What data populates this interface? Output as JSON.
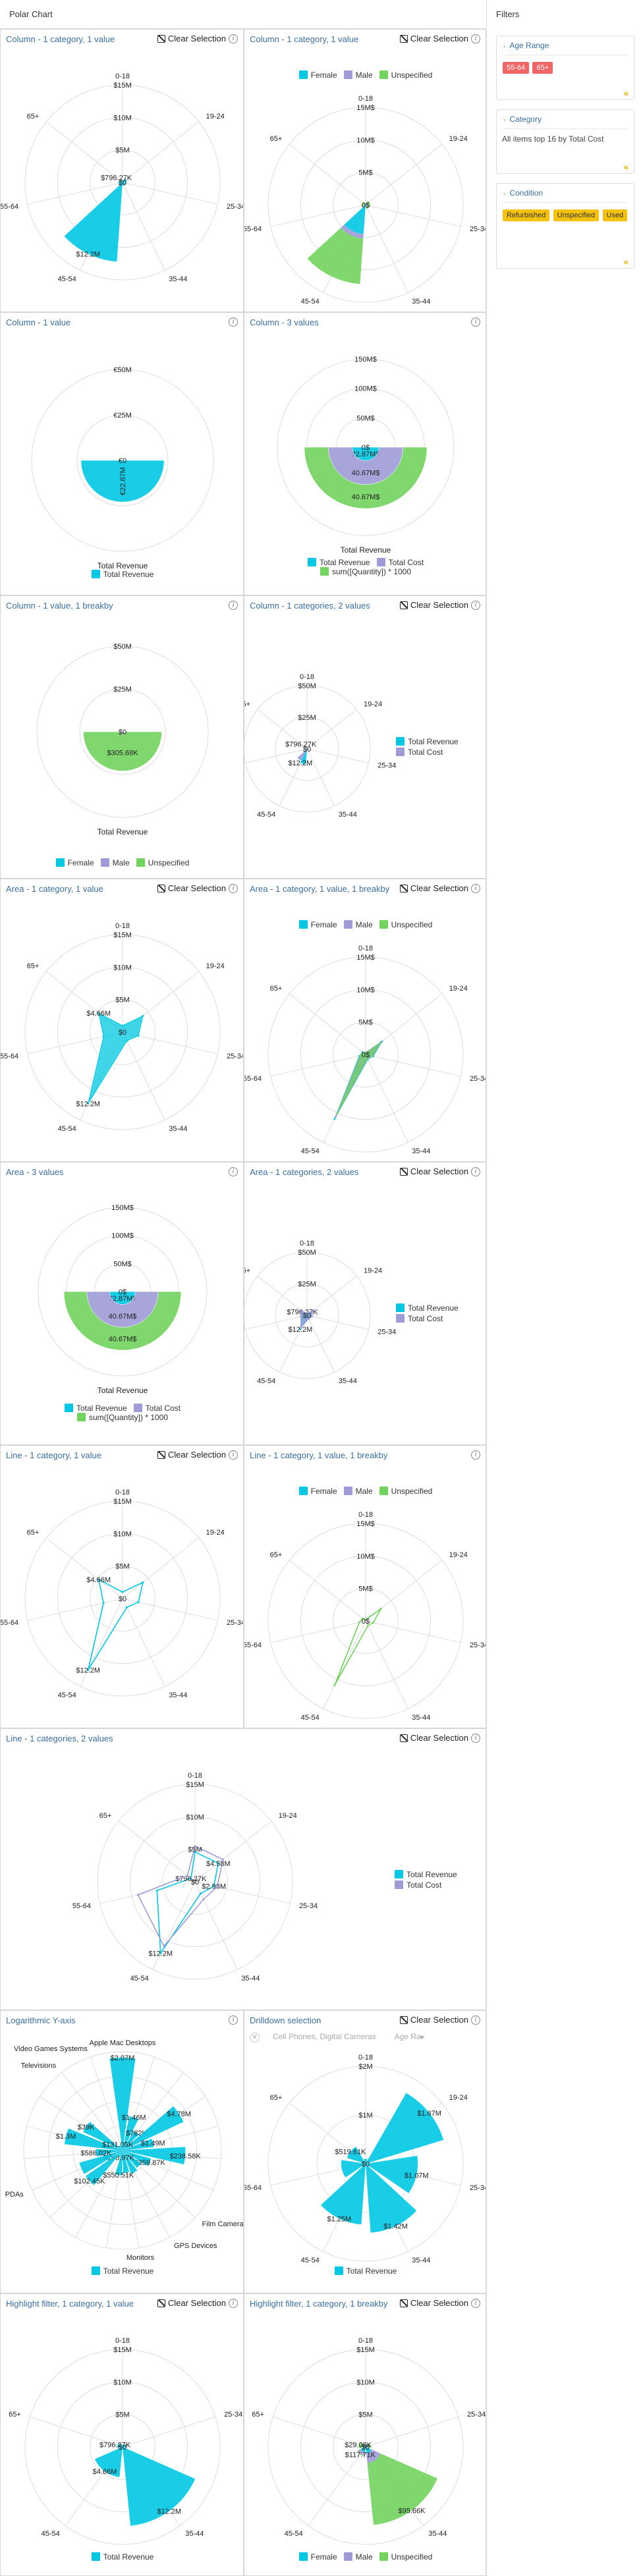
{
  "app": {
    "title": "Polar Chart"
  },
  "clear_label": "Clear Selection",
  "info_glyph": "i",
  "colors": {
    "cyan": "#00c8e3",
    "purple": "#9f9bd6",
    "green": "#72d35e",
    "grid": "#dddddd",
    "chip_red": "#f06566",
    "chip_yellow": "#f4c20d",
    "link": "#3c6e9e"
  },
  "panels": {
    "p1": {
      "title": "Column - 1 category, 1 value",
      "legend": [
        "Total Revenue"
      ]
    },
    "p2": {
      "title": "Column - 1 category, 1 value",
      "legend": [
        "Female",
        "Male",
        "Unspecified"
      ]
    },
    "p3": {
      "title": "Column - 1 value",
      "axis_label": "Total Revenue",
      "legend": [
        "Total Revenue"
      ]
    },
    "p4": {
      "title": "Column - 3 values",
      "axis_label": "Total Revenue",
      "legend": [
        "Total Revenue",
        "Total Cost",
        "sum([Quantity]) * 1000"
      ]
    },
    "p5": {
      "title": "Column - 1 value, 1 breakby",
      "axis_label": "Total Revenue",
      "legend": [
        "Female",
        "Male",
        "Unspecified"
      ]
    },
    "p6": {
      "title": "Column - 1 categories, 2 values",
      "legend": [
        "Total Revenue",
        "Total Cost"
      ]
    },
    "p7": {
      "title": "Area - 1 category, 1 value",
      "legend": [
        "Total Revenue"
      ]
    },
    "p8": {
      "title": "Area - 1 category, 1 value, 1 breakby",
      "legend": [
        "Female",
        "Male",
        "Unspecified"
      ]
    },
    "p9": {
      "title": "Area - 3 values",
      "axis_label": "Total Revenue",
      "legend": [
        "Total Revenue",
        "Total Cost",
        "sum([Quantity]) * 1000"
      ]
    },
    "p10": {
      "title": "Area - 1 categories, 2 values",
      "legend": [
        "Total Revenue",
        "Total Cost"
      ]
    },
    "p11": {
      "title": "Line - 1 category, 1 value",
      "legend": [
        "Total Revenue"
      ]
    },
    "p12": {
      "title": "Line - 1 category, 1 value, 1 breakby",
      "legend": [
        "Female",
        "Male",
        "Unspecified"
      ]
    },
    "p13": {
      "title": "Line - 1 categories, 2 values",
      "legend": [
        "Total Revenue",
        "Total Cost"
      ]
    },
    "p14": {
      "title": "Logarithmic Y-axis",
      "legend": [
        "Total Revenue"
      ]
    },
    "p15": {
      "title": "Drilldown selection",
      "breadcrumb": [
        "Cell Phones, Digital Cameras",
        "Age Ra▸"
      ],
      "close_glyph": "✕",
      "legend": [
        "Total Revenue"
      ]
    },
    "p16": {
      "title": "Highlight filter, 1 category, 1 value",
      "legend": [
        "Total Revenue"
      ]
    },
    "p17": {
      "title": "Highlight filter, 1 category, 1 breakby",
      "legend": [
        "Female",
        "Male",
        "Unspecified"
      ]
    }
  },
  "filters": {
    "title": "Filters",
    "collapse_glyph": "«",
    "chevron_glyph": "›",
    "sections": [
      {
        "title": "Age Range",
        "chips": [
          "55-64",
          "65+"
        ],
        "chip_color": "#f06566"
      },
      {
        "title": "Category",
        "text": "All items top 16 by Total Cost"
      },
      {
        "title": "Condition",
        "chips": [
          "Refurbished",
          "Unspecified",
          "Used"
        ],
        "chip_color": "#f4c20d"
      }
    ]
  },
  "chart_data": [
    {
      "panel": "Column - 1 category, 1 value",
      "type": "polar-column",
      "categories": [
        "0-18",
        "19-24",
        "25-34",
        "35-44",
        "45-54",
        "55-64",
        "65+"
      ],
      "ticks": [
        "$15M",
        "$10M",
        "$5M",
        "$0"
      ],
      "series": [
        {
          "name": "Total Revenue",
          "values": [
            0.3,
            0.7,
            0.5,
            0.5,
            12.2,
            0.6,
            0.4
          ],
          "labels": [
            "",
            "",
            "",
            "",
            "$12.2M",
            "",
            "$796.27K"
          ]
        }
      ]
    },
    {
      "panel": "Column - 1 category, 1 value",
      "type": "polar-column",
      "categories": [
        "0-18",
        "19-24",
        "25-34",
        "35-44",
        "45-54",
        "55-64",
        "65+"
      ],
      "ticks": [
        "15M$",
        "10M$",
        "5M$",
        "0$"
      ],
      "series": [
        {
          "name": "Female",
          "values": [
            0,
            0.1,
            0.1,
            0.1,
            4.5,
            0.1,
            0.1
          ]
        },
        {
          "name": "Male",
          "values": [
            0.1,
            0.2,
            0.2,
            0.2,
            0.7,
            0.2,
            0.2
          ]
        },
        {
          "name": "Unspecified",
          "values": [
            0.2,
            0.4,
            0.4,
            0.3,
            7.0,
            0.3,
            0.2
          ]
        }
      ]
    },
    {
      "panel": "Column - 1 value",
      "type": "polar-column",
      "categories": [
        ""
      ],
      "ticks": [
        "€50M",
        "€25M",
        "€0"
      ],
      "series": [
        {
          "name": "Total Revenue",
          "values": [
            22.87
          ],
          "labels": [
            "€22.87M"
          ]
        }
      ]
    },
    {
      "panel": "Column - 3 values",
      "type": "polar-column",
      "categories": [
        ""
      ],
      "ticks": [
        "150M$",
        "100M$",
        "50M$",
        "0$"
      ],
      "series": [
        {
          "name": "Total Revenue",
          "values": [
            22.87
          ],
          "labels": [
            "22.87M$"
          ]
        },
        {
          "name": "Total Cost",
          "values": [
            40.67
          ],
          "labels": [
            "40.67M$"
          ]
        },
        {
          "name": "sum([Quantity]) * 1000",
          "values": [
            40.67
          ],
          "labels": [
            "40.67M$"
          ]
        }
      ]
    },
    {
      "panel": "Column - 1 value, 1 breakby",
      "type": "polar-column",
      "categories": [
        ""
      ],
      "ticks": [
        "$50M",
        "$25M",
        "$0"
      ],
      "series": [
        {
          "name": "Female",
          "values": [
            0.3
          ]
        },
        {
          "name": "Male",
          "values": [
            1.2
          ]
        },
        {
          "name": "Unspecified",
          "values": [
            21.4
          ],
          "labels": [
            "$305.68K"
          ]
        }
      ]
    },
    {
      "panel": "Column - 1 categories, 2 values",
      "type": "polar-column",
      "categories": [
        "0-18",
        "19-24",
        "25-34",
        "35-44",
        "45-54",
        "55-64",
        "65+"
      ],
      "ticks": [
        "$50M",
        "$25M",
        "$0"
      ],
      "series": [
        {
          "name": "Total Revenue",
          "values": [
            0.3,
            0.7,
            0.5,
            0.5,
            12.2,
            0.6,
            0.8
          ],
          "labels": [
            "",
            "",
            "",
            "",
            "$12.2M",
            "",
            "$796.27K"
          ]
        },
        {
          "name": "Total Cost",
          "values": [
            0.6,
            1.4,
            1.0,
            1.0,
            10.5,
            1.2,
            1.5
          ]
        }
      ]
    },
    {
      "panel": "Area - 1 category, 1 value",
      "type": "polar-area",
      "categories": [
        "0-18",
        "19-24",
        "25-34",
        "35-44",
        "45-54",
        "55-64",
        "65+"
      ],
      "ticks": [
        "$15M",
        "$10M",
        "$5M",
        "$0"
      ],
      "series": [
        {
          "name": "Total Revenue",
          "values": [
            1.0,
            4.0,
            2.5,
            1.5,
            12.2,
            3.0,
            4.7
          ],
          "labels": [
            "",
            "",
            "",
            "",
            "$12.2M",
            "",
            "$4.66M"
          ]
        }
      ]
    },
    {
      "panel": "Area - 1 category, 1 value, 1 breakby",
      "type": "polar-area",
      "categories": [
        "0-18",
        "19-24",
        "25-34",
        "35-44",
        "45-54",
        "55-64",
        "65+"
      ],
      "ticks": [
        "15M$",
        "10M$",
        "5M$",
        "0$"
      ],
      "series": [
        {
          "name": "Female",
          "values": [
            0.3,
            3.2,
            1.2,
            0.8,
            11.0,
            1.0,
            0.6
          ]
        },
        {
          "name": "Male",
          "values": [
            0.3,
            3.0,
            1.1,
            0.7,
            10.6,
            0.9,
            0.5
          ]
        },
        {
          "name": "Unspecified",
          "values": [
            0.2,
            2.8,
            1.0,
            0.6,
            10.0,
            0.8,
            0.5
          ]
        }
      ]
    },
    {
      "panel": "Area - 3 values",
      "type": "polar-area",
      "categories": [
        ""
      ],
      "ticks": [
        "150M$",
        "100M$",
        "50M$",
        "0$"
      ],
      "series": [
        {
          "name": "Total Revenue",
          "values": [
            22.87
          ],
          "labels": [
            "22.87M$"
          ]
        },
        {
          "name": "Total Cost",
          "values": [
            40.67
          ],
          "labels": [
            "40.67M$"
          ]
        },
        {
          "name": "sum([Quantity]) * 1000",
          "values": [
            40.67
          ],
          "labels": [
            "40.67M$"
          ]
        }
      ]
    },
    {
      "panel": "Area - 1 categories, 2 values",
      "type": "polar-area",
      "categories": [
        "0-18",
        "19-24",
        "25-34",
        "35-44",
        "45-54",
        "55-64",
        "65+"
      ],
      "ticks": [
        "$50M",
        "$25M",
        "$0"
      ],
      "series": [
        {
          "name": "Total Revenue",
          "values": [
            0.8,
            4.5,
            3.0,
            2.0,
            12.2,
            4.0,
            4.7
          ],
          "labels": [
            "",
            "",
            "",
            "",
            "$12.2M",
            "",
            "$796.27K"
          ]
        },
        {
          "name": "Total Cost",
          "values": [
            1.5,
            6.0,
            4.0,
            3.0,
            11.0,
            5.0,
            6.0
          ]
        }
      ]
    },
    {
      "panel": "Line - 1 category, 1 value",
      "type": "polar-line",
      "categories": [
        "0-18",
        "19-24",
        "25-34",
        "35-44",
        "45-54",
        "55-64",
        "65+"
      ],
      "ticks": [
        "$15M",
        "$10M",
        "$5M",
        "$0"
      ],
      "series": [
        {
          "name": "Total Revenue",
          "values": [
            1.0,
            4.0,
            2.5,
            1.5,
            12.2,
            3.0,
            4.7
          ],
          "labels": [
            "",
            "",
            "",
            "",
            "$12.2M",
            "",
            "$4.66M"
          ]
        }
      ]
    },
    {
      "panel": "Line - 1 category, 1 value, 1 breakby",
      "type": "polar-line",
      "categories": [
        "0-18",
        "19-24",
        "25-34",
        "35-44",
        "45-54",
        "55-64",
        "65+"
      ],
      "ticks": [
        "15M$",
        "10M$",
        "5M$",
        "0$"
      ],
      "series": [
        {
          "name": "Unspecified",
          "values": [
            0.2,
            3.0,
            1.2,
            0.8,
            11.0,
            1.0,
            0.6
          ]
        }
      ]
    },
    {
      "panel": "Line - 1 categories, 2 values",
      "type": "polar-line",
      "categories": [
        "0-18",
        "19-24",
        "25-34",
        "35-44",
        "45-54",
        "55-64",
        "65+"
      ],
      "ticks": [
        "$15M",
        "$10M",
        "$5M",
        "$0"
      ],
      "series": [
        {
          "name": "Total Revenue",
          "values": [
            4.58,
            4.58,
            2.98,
            2.0,
            12.2,
            6.0,
            0.8
          ],
          "labels": [
            "",
            "$4.58M",
            "$2.98M",
            "",
            "$12.2M",
            "",
            "$796.27K"
          ]
        },
        {
          "name": "Total Cost",
          "values": [
            5.5,
            5.5,
            3.5,
            3.0,
            11.0,
            9.0,
            1.5
          ]
        }
      ]
    },
    {
      "panel": "Logarithmic Y-axis",
      "type": "polar-column",
      "scale": "log",
      "categories": [
        "Apple Mac Desktops",
        "",
        "",
        "",
        "",
        "",
        "",
        "Film Cameras",
        "GPS Devices",
        "Monitors",
        "",
        "",
        "",
        "PDAs",
        "",
        "",
        "",
        "Televisions",
        "Video Games Systems"
      ],
      "series": [
        {
          "name": "Total Revenue",
          "values": [
            2.07,
            0.78,
            0.5,
            1.5,
            0.7,
            1.4,
            0.66,
            0.5,
            0.55,
            0.5,
            0.55,
            0.16,
            1.0,
            1.0,
            0.59,
            1.3,
            0.97,
            0.13,
            0.13
          ],
          "labels": [
            "$2.07M",
            "$1.46M",
            "$762K",
            "$4.78M",
            "$1.49M",
            "$238.58K",
            "$359.87K",
            "",
            "",
            "",
            "$550.51K",
            "$168.97K",
            "$102.45K",
            "",
            "$586.02K",
            "$1.3M",
            "$39K",
            "$131.05K",
            ""
          ]
        }
      ]
    },
    {
      "panel": "Drilldown selection",
      "type": "polar-column",
      "categories": [
        "0-18",
        "19-24",
        "25-34",
        "35-44",
        "45-54",
        "55-64",
        "65+"
      ],
      "ticks": [
        "$2M",
        "$1M",
        "$0"
      ],
      "series": [
        {
          "name": "Total Revenue",
          "values": [
            0.1,
            1.67,
            1.07,
            1.42,
            1.25,
            0.5,
            0.4
          ],
          "labels": [
            "",
            "$1.67M",
            "$1.07M",
            "$1.42M",
            "$1.25M",
            "",
            "$519.61K"
          ]
        }
      ]
    },
    {
      "panel": "Highlight filter, 1 category, 1 value",
      "type": "polar-column",
      "categories": [
        "0-18",
        "25-34",
        "35-44",
        "45-54",
        "65+"
      ],
      "ticks": [
        "$15M",
        "$10M",
        "$5M",
        "$0"
      ],
      "series": [
        {
          "name": "Total Revenue",
          "values": [
            0.3,
            0.5,
            12.2,
            4.66,
            0.8
          ],
          "labels": [
            "",
            "",
            "$12.2M",
            "$4.66M",
            "$796.27K"
          ]
        }
      ]
    },
    {
      "panel": "Highlight filter, 1 category, 1 breakby",
      "type": "polar-column",
      "categories": [
        "0-18",
        "25-34",
        "35-44",
        "45-54",
        "65+"
      ],
      "ticks": [
        "$15M",
        "$10M",
        "$5M",
        "$0"
      ],
      "series": [
        {
          "name": "Female",
          "values": [
            0.1,
            0.2,
            1.0,
            0.8,
            0.3
          ]
        },
        {
          "name": "Male",
          "values": [
            0.1,
            0.2,
            1.5,
            0.5,
            0.2
          ]
        },
        {
          "name": "Unspecified",
          "values": [
            0.2,
            0.3,
            9.57,
            0.12,
            0.5
          ],
          "labels": [
            "",
            "",
            "$95.66K",
            "$117.71K",
            "$29.08K"
          ]
        }
      ]
    }
  ]
}
